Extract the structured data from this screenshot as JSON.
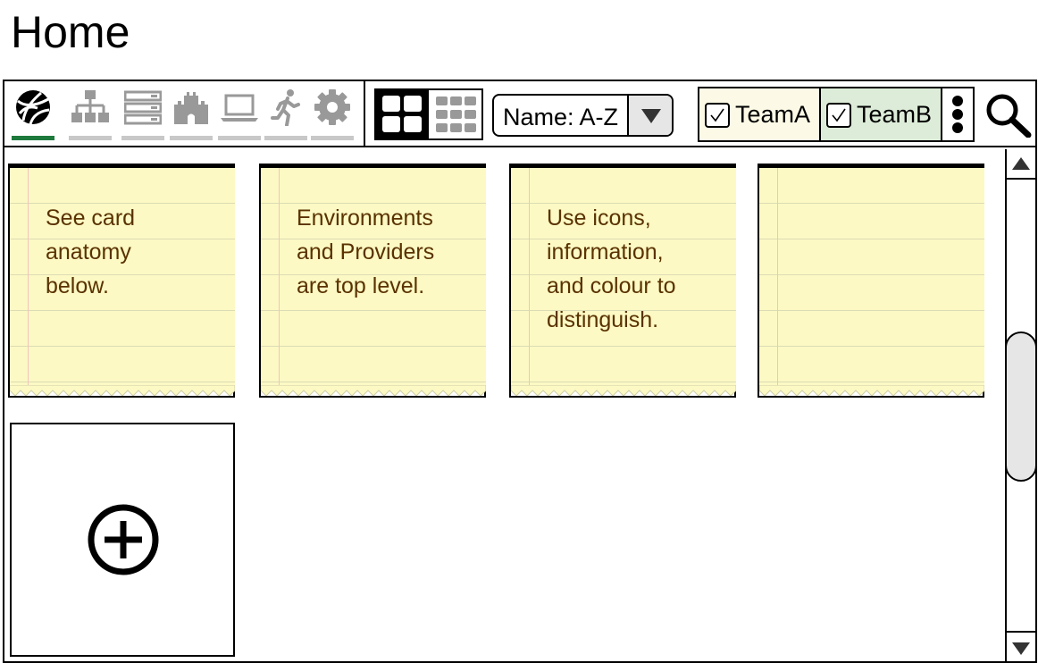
{
  "page": {
    "title": "Home"
  },
  "toolbar": {
    "nav_items": [
      {
        "icon": "globe-icon",
        "active": true
      },
      {
        "icon": "org-chart-icon",
        "active": false
      },
      {
        "icon": "server-stack-icon",
        "active": false
      },
      {
        "icon": "castle-icon",
        "active": false
      },
      {
        "icon": "laptop-icon",
        "active": false
      },
      {
        "icon": "running-person-icon",
        "active": false
      },
      {
        "icon": "gear-icon",
        "active": false
      }
    ],
    "view_toggle": {
      "selected": "large-grid",
      "options": [
        "large-grid-icon",
        "small-grid-icon"
      ]
    },
    "sort": {
      "value": "Name: A-Z"
    },
    "filters": {
      "teams": [
        {
          "label": "TeamA",
          "checked": true,
          "color": "#fcfae6"
        },
        {
          "label": "TeamB",
          "checked": true,
          "color": "#dcecd8"
        }
      ]
    }
  },
  "cards": [
    {
      "text": "See card\nanatomy\nbelow."
    },
    {
      "text": "Environments\nand Providers\nare top level."
    },
    {
      "text": "Use icons,\ninformation,\nand colour to\ndistinguish."
    },
    {
      "text": ""
    }
  ],
  "colors": {
    "note_background": "#fcf9c4",
    "note_text": "#5a3200",
    "active_tab_underline": "#1e7a3c",
    "inactive_tab_underline": "#c8c8c8"
  }
}
